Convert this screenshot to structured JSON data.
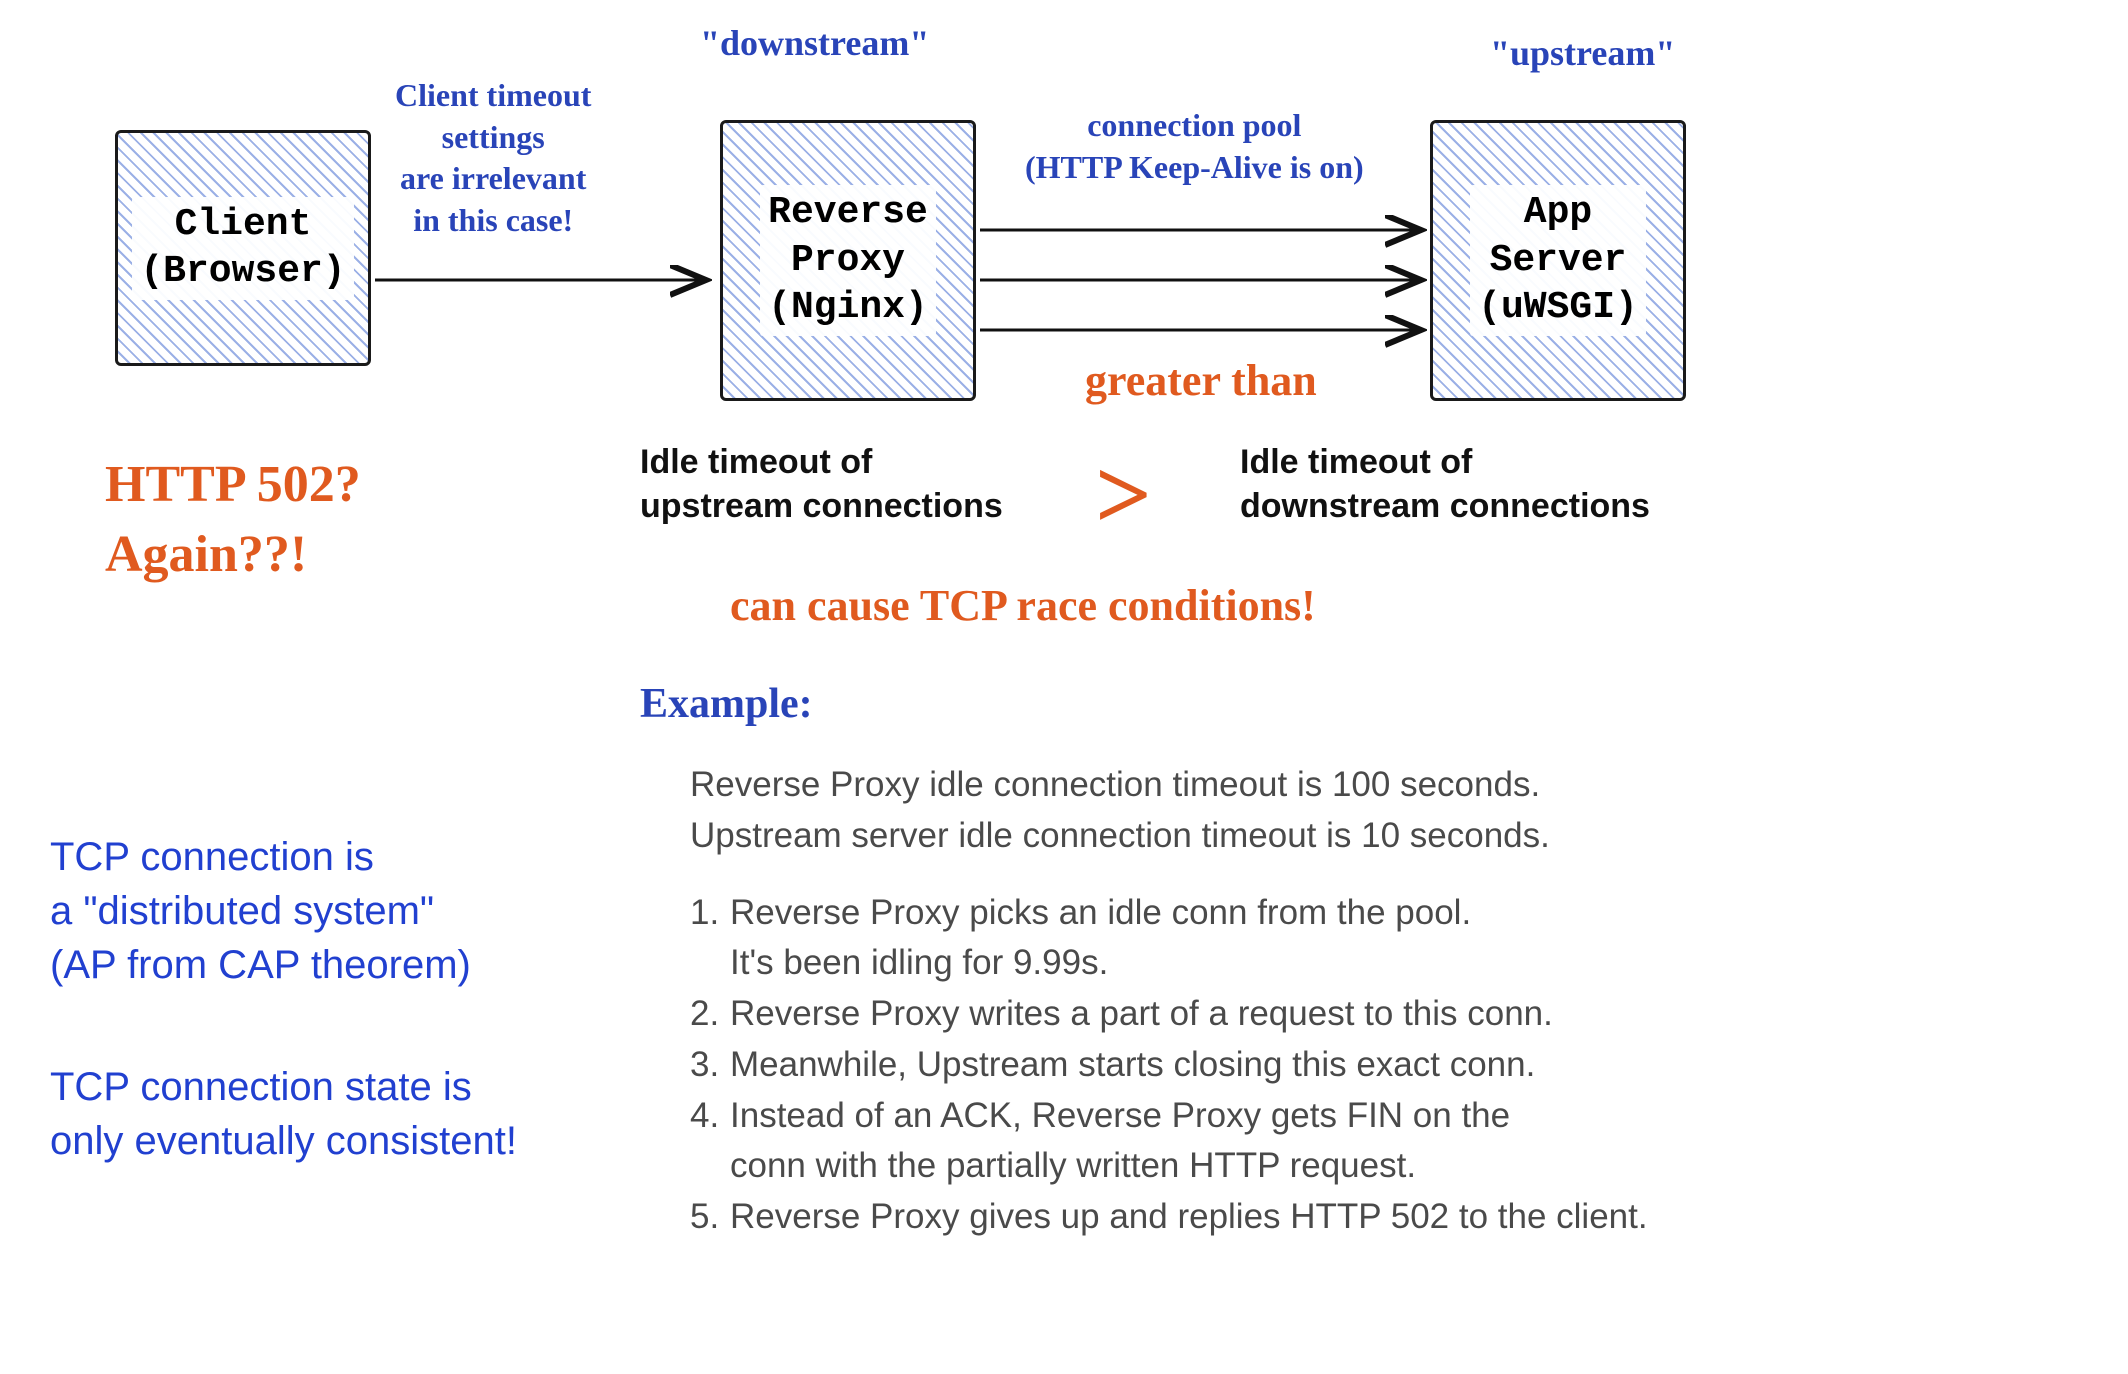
{
  "labels": {
    "downstream": "\"downstream\"",
    "upstream": "\"upstream\"",
    "client_note": "Client timeout\nsettings\nare irrelevant\nin this case!",
    "pool_note": "connection pool\n(HTTP Keep-Alive is on)",
    "greater_than_text": "greater than",
    "idle_left": "Idle timeout of\nupstream connections",
    "idle_right": "Idle timeout of\ndownstream connections",
    "race": "can cause TCP race conditions!",
    "gt_symbol": ">",
    "http502": "HTTP 502?\n Again??!",
    "tcp_dist": "TCP connection is\na \"distributed system\"\n(AP from CAP theorem)",
    "tcp_state": "TCP connection state is\nonly eventually consistent!",
    "example_head": "Example:",
    "example_intro": "Reverse Proxy idle connection timeout is 100 seconds.\nUpstream server idle connection timeout is 10 seconds.",
    "step1": "Reverse Proxy picks an idle conn from the pool.\nIt's been idling for 9.99s.",
    "step2": "Reverse Proxy writes a part of a request to this conn.",
    "step3": "Meanwhile, Upstream starts closing this exact conn.",
    "step4": "Instead of an ACK, Reverse Proxy gets FIN on the\nconn with the partially written HTTP request.",
    "step5": "Reverse Proxy gives up and replies HTTP 502 to the client."
  },
  "boxes": {
    "client": "Client\n(Browser)",
    "proxy": "Reverse\nProxy\n(Nginx)",
    "app": "App\nServer\n(uWSGI)"
  }
}
